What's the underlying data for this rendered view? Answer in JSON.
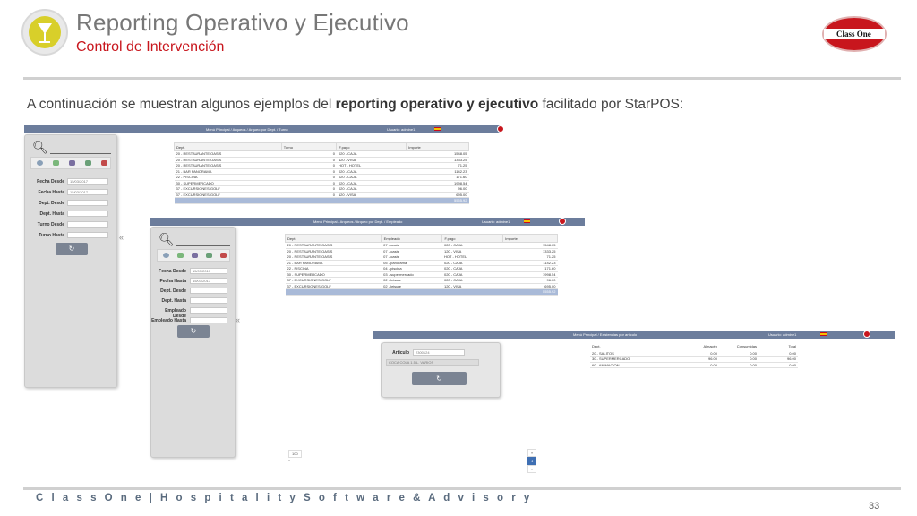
{
  "header": {
    "title": "Reporting Operativo y Ejecutivo",
    "subtitle": "Control de Intervención",
    "brand_logo_text": "Class One"
  },
  "intro": {
    "before": "A continuación se muestran algunos ejemplos del ",
    "bold": "reporting operativo y ejecutivo",
    "after": " facilitado por StarPOS:"
  },
  "screen1": {
    "nav": "Menú Principal / Arqueos / Arqueo por Dept. / Turno",
    "user": "Usuario: admine1",
    "filters": [
      {
        "label": "Fecha Desde",
        "value": "15/03/2017"
      },
      {
        "label": "Fecha Hasta",
        "value": "15/03/2017"
      },
      {
        "label": "Dept. Desde",
        "value": ""
      },
      {
        "label": "Dept. Hasta",
        "value": ""
      },
      {
        "label": "Turno Desde",
        "value": ""
      },
      {
        "label": "Turno Hasta",
        "value": ""
      }
    ],
    "columns": [
      "Dept.",
      "Turno",
      "F.pago",
      "Importe"
    ],
    "rows": [
      [
        "20 - RESTAURANTE OASIS",
        "0",
        "020 - CAJA",
        "1548.05"
      ],
      [
        "20 - RESTAURANTE OASIS",
        "0",
        "120 - VISA",
        "1333.25"
      ],
      [
        "20 - RESTAURANTE OASIS",
        "0",
        "HOT - HOTEL",
        "71.25"
      ],
      [
        "21 - BAR PANORAMA",
        "0",
        "020 - CAJA",
        "1142.23"
      ],
      [
        "22 - PISCINA",
        "0",
        "020 - CAJA",
        "171.60"
      ],
      [
        "30 - SUPERMERCADO",
        "0",
        "020 - CAJA",
        "1998.54"
      ],
      [
        "37 - EXCURSIONES-GOLF",
        "0",
        "020 - CAJA",
        "96.00"
      ],
      [
        "37 - EXCURSIONES-GOLF",
        "0",
        "120 - VISA",
        "695.00"
      ]
    ],
    "total": "5555.92"
  },
  "screen2": {
    "nav": "Menú Principal / Arqueos / Arqueo por Dept. / Empleado",
    "user": "Usuario: admine1",
    "filters": [
      {
        "label": "Fecha Desde",
        "value": "15/03/2017"
      },
      {
        "label": "Fecha Hasta",
        "value": "15/03/2017"
      },
      {
        "label": "Dept. Desde",
        "value": ""
      },
      {
        "label": "Dept. Hasta",
        "value": ""
      },
      {
        "label": "Empleado Desde",
        "value": ""
      },
      {
        "label": "Empleado Hasta",
        "value": ""
      }
    ],
    "columns": [
      "Dept.",
      "Empleado",
      "F.pago",
      "Importe"
    ],
    "rows": [
      [
        "20 - RESTAURANTE OASIS",
        "07 - oasis",
        "020 - CAJA",
        "1548.05"
      ],
      [
        "20 - RESTAURANTE OASIS",
        "07 - oasis",
        "120 - VISA",
        "1333.25"
      ],
      [
        "20 - RESTAURANTE OASIS",
        "07 - oasis",
        "HOT - HOTEL",
        "71.25"
      ],
      [
        "21 - BAR PANORAMA",
        "05 - panorama",
        "020 - CAJA",
        "1142.23"
      ],
      [
        "22 - PISCINA",
        "04 - piscina",
        "020 - CAJA",
        "171.60"
      ],
      [
        "30 - SUPERMERCADO",
        "03 - supermercado",
        "020 - CAJA",
        "1998.54"
      ],
      [
        "37 - EXCURSIONES-GOLF",
        "02 - leisure",
        "020 - CAJA",
        "96.00"
      ],
      [
        "37 - EXCURSIONES-GOLF",
        "02 - leisure",
        "120 - VISA",
        "695.00"
      ]
    ],
    "total": "5555.92",
    "page_size": "100"
  },
  "screen3": {
    "nav": "Menú Principal / Existencias por artículo",
    "user": "Usuario: admine1",
    "article_label": "Articulo",
    "article_code": "2300124",
    "article_name": "COCA COLA 1.5 L. VARIOS",
    "columns": [
      "Dept.",
      "Almacén",
      "Consumidas",
      "Total"
    ],
    "rows": [
      [
        "20 - SALITOS",
        "0.00",
        "0.00",
        "0.00"
      ],
      [
        "30 - SUPERMERCADO",
        "96.00",
        "0.00",
        "96.00"
      ],
      [
        "60 - ANIMACION",
        "0.00",
        "0.00",
        "0.00"
      ]
    ],
    "pager": {
      "prev": "«",
      "current": "1",
      "next": "»"
    }
  },
  "footer": {
    "text": "C l a s s O n e | H o s p i t a l i t y S o f t w a r e & A d v i s o r y",
    "page_number": "33"
  }
}
